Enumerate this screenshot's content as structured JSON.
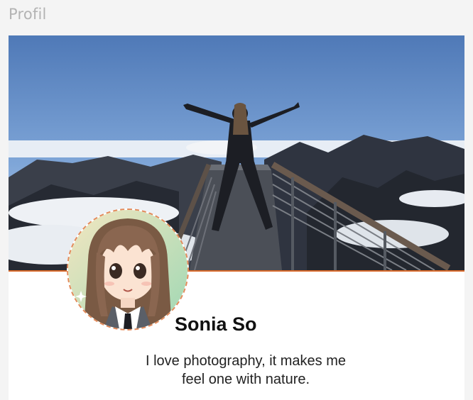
{
  "page": {
    "title": "Profil"
  },
  "profile": {
    "name": "Sonia So",
    "bio": "I love photography, it makes me feel one with nature."
  },
  "colors": {
    "accent": "#d96a2b",
    "avatar_border": "#e48a5a",
    "title_text": "#b3b3b3"
  },
  "icons": {
    "cover": "mountain-photo",
    "avatar": "anime-girl-avatar"
  }
}
